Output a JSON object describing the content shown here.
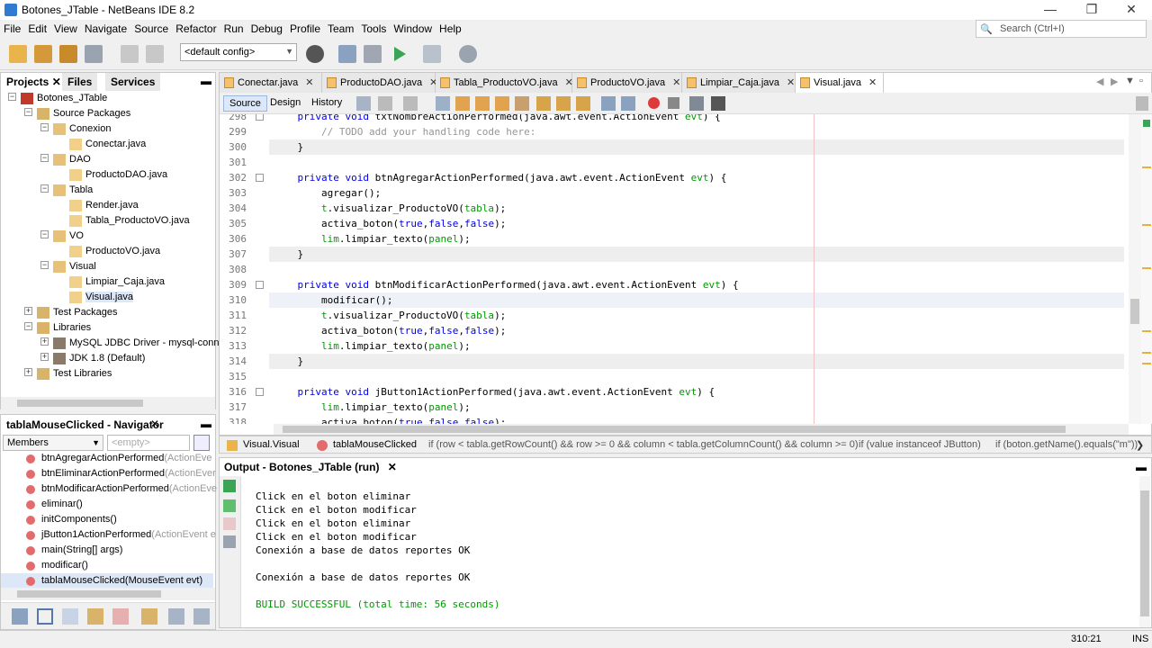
{
  "window": {
    "title": "Botones_JTable - NetBeans IDE 8.2",
    "min": "—",
    "max": "❐",
    "close": "✕"
  },
  "menu": [
    "File",
    "Edit",
    "View",
    "Navigate",
    "Source",
    "Refactor",
    "Run",
    "Debug",
    "Profile",
    "Team",
    "Tools",
    "Window",
    "Help"
  ],
  "search": {
    "placeholder": "Search (Ctrl+I)"
  },
  "toolbar": {
    "config_value": "<default config>"
  },
  "projects": {
    "tabs": [
      "Projects",
      "Files",
      "Services"
    ],
    "tree": [
      {
        "label": "Botones_JTable",
        "level": 0,
        "kind": "project"
      },
      {
        "label": "Source Packages",
        "level": 1,
        "kind": "folder"
      },
      {
        "label": "Conexion",
        "level": 2,
        "kind": "package"
      },
      {
        "label": "Conectar.java",
        "level": 3,
        "kind": "java"
      },
      {
        "label": "DAO",
        "level": 2,
        "kind": "package"
      },
      {
        "label": "ProductoDAO.java",
        "level": 3,
        "kind": "java"
      },
      {
        "label": "Tabla",
        "level": 2,
        "kind": "package"
      },
      {
        "label": "Render.java",
        "level": 3,
        "kind": "java"
      },
      {
        "label": "Tabla_ProductoVO.java",
        "level": 3,
        "kind": "java"
      },
      {
        "label": "VO",
        "level": 2,
        "kind": "package"
      },
      {
        "label": "ProductoVO.java",
        "level": 3,
        "kind": "java"
      },
      {
        "label": "Visual",
        "level": 2,
        "kind": "package"
      },
      {
        "label": "Limpiar_Caja.java",
        "level": 3,
        "kind": "java"
      },
      {
        "label": "Visual.java",
        "level": 3,
        "kind": "java"
      },
      {
        "label": "Test Packages",
        "level": 1,
        "kind": "folder"
      },
      {
        "label": "Libraries",
        "level": 1,
        "kind": "folder"
      },
      {
        "label": "MySQL JDBC Driver - mysql-connec",
        "level": 2,
        "kind": "jar"
      },
      {
        "label": "JDK 1.8 (Default)",
        "level": 2,
        "kind": "jar"
      },
      {
        "label": "Test Libraries",
        "level": 1,
        "kind": "folder"
      }
    ]
  },
  "navigator": {
    "title": "tablaMouseClicked - Navigator",
    "filter_label": "Members",
    "filter_placeholder": "<empty>",
    "items": [
      {
        "name": "btnAgregarActionPerformed",
        "param": "(ActionEve"
      },
      {
        "name": "btnEliminarActionPerformed",
        "param": "(ActionEver"
      },
      {
        "name": "btnModificarActionPerformed",
        "param": "(ActionEve"
      },
      {
        "name": "eliminar()",
        "param": ""
      },
      {
        "name": "initComponents()",
        "param": ""
      },
      {
        "name": "jButton1ActionPerformed",
        "param": "(ActionEvent e"
      },
      {
        "name": "main(String[] args)",
        "param": ""
      },
      {
        "name": "modificar()",
        "param": ""
      },
      {
        "name": "tablaMouseClicked(MouseEvent evt)",
        "param": ""
      }
    ]
  },
  "editor": {
    "tabs": [
      "Conectar.java",
      "ProductoDAO.java",
      "Tabla_ProductoVO.java",
      "ProductoVO.java",
      "Limpiar_Caja.java",
      "Visual.java"
    ],
    "active_tab": "Visual.java",
    "source_tabs": [
      "Source",
      "Design",
      "History"
    ],
    "lines": [
      {
        "n": "298",
        "t": "    private void txtNombreActionPerformed(java.awt.event.ActionEvent evt) {"
      },
      {
        "n": "299",
        "t": "        // TODO add your handling code here:"
      },
      {
        "n": "300",
        "t": "    }"
      },
      {
        "n": "301",
        "t": ""
      },
      {
        "n": "302",
        "t": "    private void btnAgregarActionPerformed(java.awt.event.ActionEvent evt) {"
      },
      {
        "n": "303",
        "t": "        agregar();"
      },
      {
        "n": "304",
        "t": "        t.visualizar_ProductoVO(tabla);"
      },
      {
        "n": "305",
        "t": "        activa_boton(true,false,false);"
      },
      {
        "n": "306",
        "t": "        lim.limpiar_texto(panel);"
      },
      {
        "n": "307",
        "t": "    }"
      },
      {
        "n": "308",
        "t": ""
      },
      {
        "n": "309",
        "t": "    private void btnModificarActionPerformed(java.awt.event.ActionEvent evt) {"
      },
      {
        "n": "310",
        "t": "        modificar();"
      },
      {
        "n": "311",
        "t": "        t.visualizar_ProductoVO(tabla);"
      },
      {
        "n": "312",
        "t": "        activa_boton(true,false,false);"
      },
      {
        "n": "313",
        "t": "        lim.limpiar_texto(panel);"
      },
      {
        "n": "314",
        "t": "    }"
      },
      {
        "n": "315",
        "t": ""
      },
      {
        "n": "316",
        "t": "    private void jButton1ActionPerformed(java.awt.event.ActionEvent evt) {"
      },
      {
        "n": "317",
        "t": "        lim.limpiar_texto(panel);"
      },
      {
        "n": "318",
        "t": "        activa_boton(true,false,false);"
      }
    ]
  },
  "breadcrumbs": [
    "Visual.Visual",
    "tablaMouseClicked",
    "if (row < tabla.getRowCount() && row >= 0 && column < tabla.getColumnCount() && column >= 0)",
    "if (value instanceof JButton)",
    "if (boton.getName().equals(\"m\"))"
  ],
  "output": {
    "title": "Output - Botones_JTable (run)",
    "lines": [
      "Click en el boton eliminar",
      "Click en el boton modificar",
      "Click en el boton eliminar",
      "Click en el boton modificar",
      "Conexión a base de datos reportes OK",
      "",
      "Conexión a base de datos reportes OK",
      "",
      "BUILD SUCCESSFUL (total time: 56 seconds)"
    ]
  },
  "status": {
    "position": "310:21",
    "mode": "INS"
  }
}
